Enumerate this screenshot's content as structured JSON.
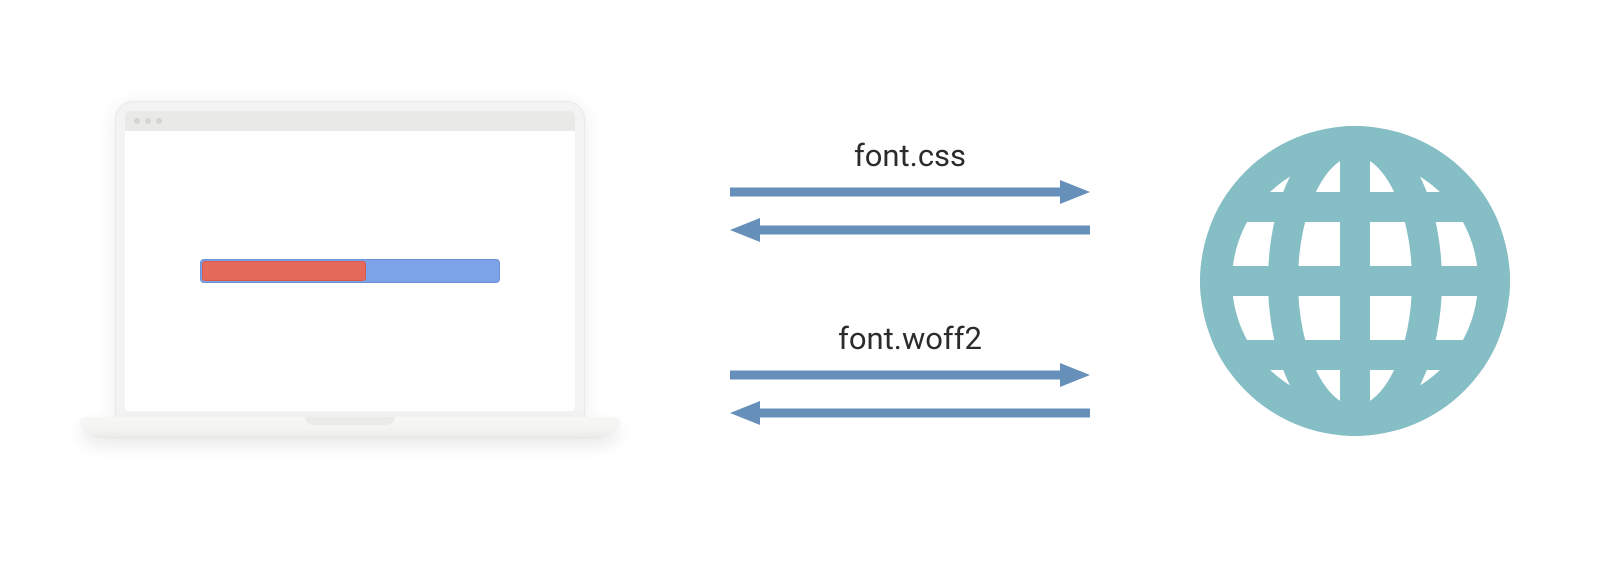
{
  "requests": {
    "top_label": "font.css",
    "bottom_label": "font.woff2"
  },
  "colors": {
    "arrow": "#6690b9",
    "globe": "#85bec5",
    "progress_blue": "#7ca3e8",
    "progress_red": "#e66a5c"
  }
}
